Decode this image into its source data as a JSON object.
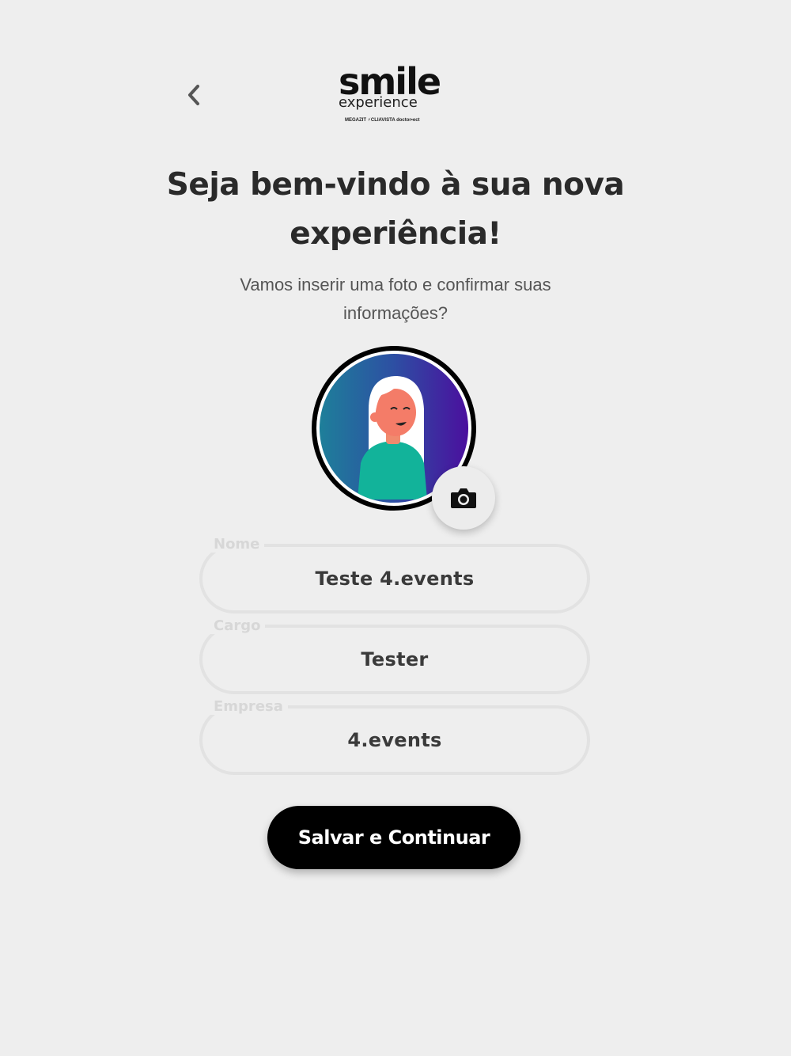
{
  "header": {
    "back_icon": "chevron-left-icon",
    "logo": {
      "main": "smile",
      "sub": "experience",
      "partners": "MEGAZIT  ⚡CLIAVISTA  doctor•ect"
    }
  },
  "intro": {
    "title": "Seja bem-vindo à sua nova experiência!",
    "subtitle": "Vamos inserir uma foto e confirmar suas informações?"
  },
  "avatar": {
    "camera_icon": "camera-icon"
  },
  "form": {
    "fields": [
      {
        "label": "Nome",
        "value": "Teste 4.events"
      },
      {
        "label": "Cargo",
        "value": "Tester"
      },
      {
        "label": "Empresa",
        "value": "4.events"
      }
    ]
  },
  "actions": {
    "save_label": "Salvar e Continuar"
  },
  "colors": {
    "background": "#eeeeee",
    "primary_button": "#000000",
    "field_border": "#e2e2e2",
    "avatar_gradient_start": "#1e7f9a",
    "avatar_gradient_end": "#4b0f9e"
  }
}
